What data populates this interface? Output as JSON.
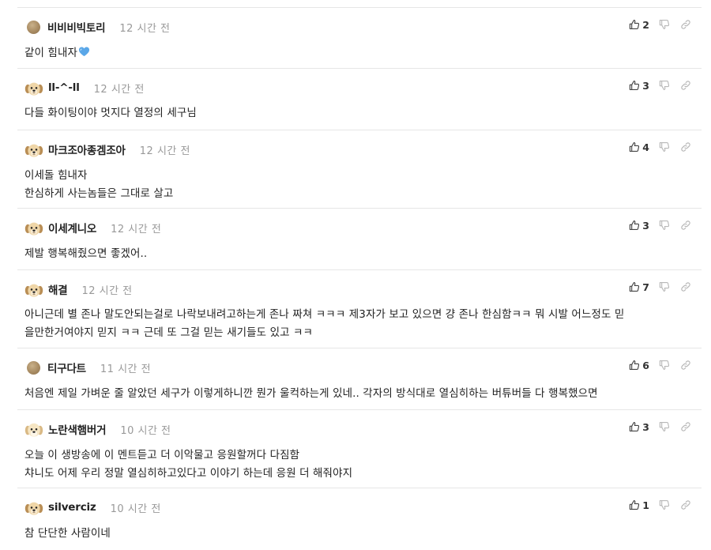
{
  "comments": [
    {
      "author": "비비비빅토리",
      "time": "12 시간 전",
      "body": "같이 힘내자",
      "emoji": "blue-heart-icon",
      "likes": "2",
      "avatar": "ball"
    },
    {
      "author": "ll-^-ll",
      "time": "12 시간 전",
      "body": "다들 화이팅이야 멋지다 열정의 세구님",
      "likes": "3",
      "avatar": "puppy"
    },
    {
      "author": "마크조아종겜조아",
      "time": "12 시간 전",
      "body": "이세돌 힘내자\n한심하게 사는놈들은 그대로 살고",
      "likes": "4",
      "avatar": "puppy"
    },
    {
      "author": "이세계니오",
      "time": "12 시간 전",
      "body": "제발 행복해줬으면 좋겠어..",
      "likes": "3",
      "avatar": "puppy"
    },
    {
      "author": "해결",
      "time": "12 시간 전",
      "body": "아니근데 별 존나 말도안되는걸로 나락보내려고하는게 존나 짜쳐 ㅋㅋㅋ 제3자가 보고 있으면 걍 존나 한심함ㅋㅋ 뭐 시발 어느정도 믿\n을만한거여야지 믿지 ㅋㅋ 근데 또 그걸 믿는 새기들도 있고 ㅋㅋ",
      "likes": "7",
      "avatar": "puppy"
    },
    {
      "author": "티구다트",
      "time": "11 시간 전",
      "body": "처음엔 제일 가벼운 줄 알았던 세구가 이렇게하니깐 뭔가 울컥하는게 있네.. 각자의 방식대로 열심히하는 버튜버들 다 행복했으면",
      "likes": "6",
      "avatar": "ball"
    },
    {
      "author": "노란색햄버거",
      "time": "10 시간 전",
      "body": "오늘 이 생방송에 이 멘트듣고 더 이악물고 응원할꺼다 다짐함\n챠니도 어제 우리 정말 열심히하고있다고 이야기 하는데 응원 더 해줘야지",
      "likes": "3",
      "avatar": "puppy-cream"
    },
    {
      "author": "silverciz",
      "time": "10 시간 전",
      "body": "참 단단한 사람이네",
      "likes": "1",
      "avatar": "puppy"
    }
  ],
  "icons": {
    "like": "thumbs-up-icon",
    "dislike": "thumbs-down-icon",
    "link": "link-icon"
  },
  "colors": {
    "divider": "#e6e6e6",
    "time": "#999999",
    "text": "#222222",
    "icon": "#444444",
    "icon_muted": "#b8b8b8",
    "heart": "#5aa7e8"
  }
}
